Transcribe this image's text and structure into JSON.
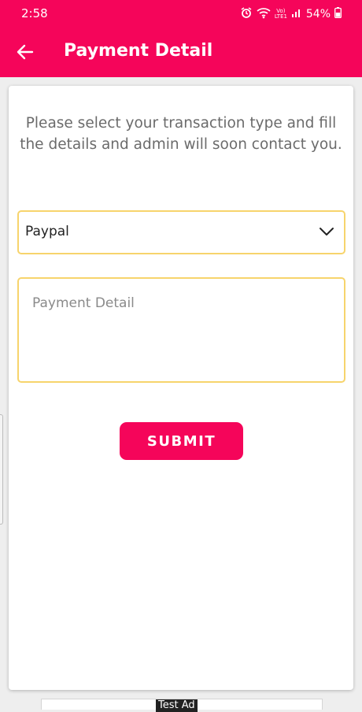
{
  "status_bar": {
    "time": "2:58",
    "network_label": "Vo) LTE1",
    "battery": "54%"
  },
  "app_bar": {
    "title": "Payment Detail",
    "color": "#f5055a"
  },
  "form": {
    "instruction": "Please select your transaction type and fill the details and admin will soon contact you.",
    "transaction_type": "Paypal",
    "detail_placeholder": "Payment Detail",
    "submit_label": "SUBMIT",
    "field_border_color": "#f7d46c"
  },
  "ad": {
    "label": "Test Ad"
  }
}
